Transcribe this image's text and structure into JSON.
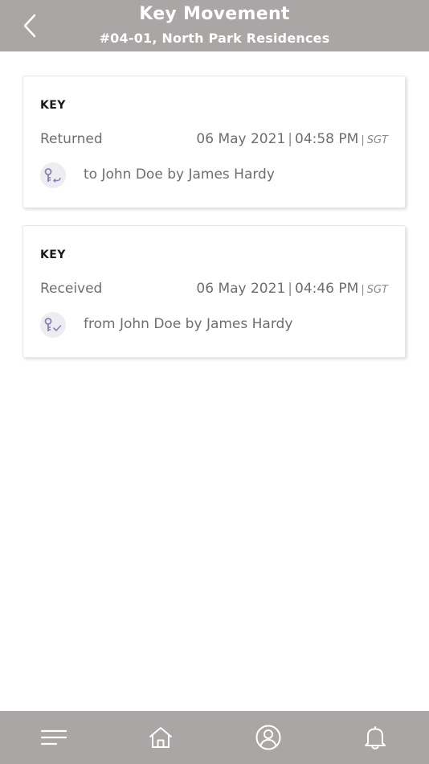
{
  "header": {
    "title": "Key Movement",
    "subtitle": "#04-01, North Park Residences",
    "back_icon": "chevron-left-icon"
  },
  "movements": [
    {
      "label": "KEY",
      "status": "Returned",
      "date": "06 May 2021",
      "separator": "|",
      "time": "04:58 PM",
      "tz_separator": "|",
      "timezone": "SGT",
      "icon": "key-return-icon",
      "detail": "to John Doe by James Hardy"
    },
    {
      "label": "KEY",
      "status": "Received",
      "date": "06 May 2021",
      "separator": "|",
      "time": "04:46 PM",
      "tz_separator": "|",
      "timezone": "SGT",
      "icon": "key-check-icon",
      "detail": "from John Doe by James Hardy"
    }
  ],
  "bottom_nav": {
    "items": [
      "menu-icon",
      "home-icon",
      "profile-icon",
      "bell-icon"
    ]
  },
  "colors": {
    "header_bg": "#aaa6a6",
    "text_muted": "#6e6e6e",
    "icon_accent": "#8a80b0"
  }
}
